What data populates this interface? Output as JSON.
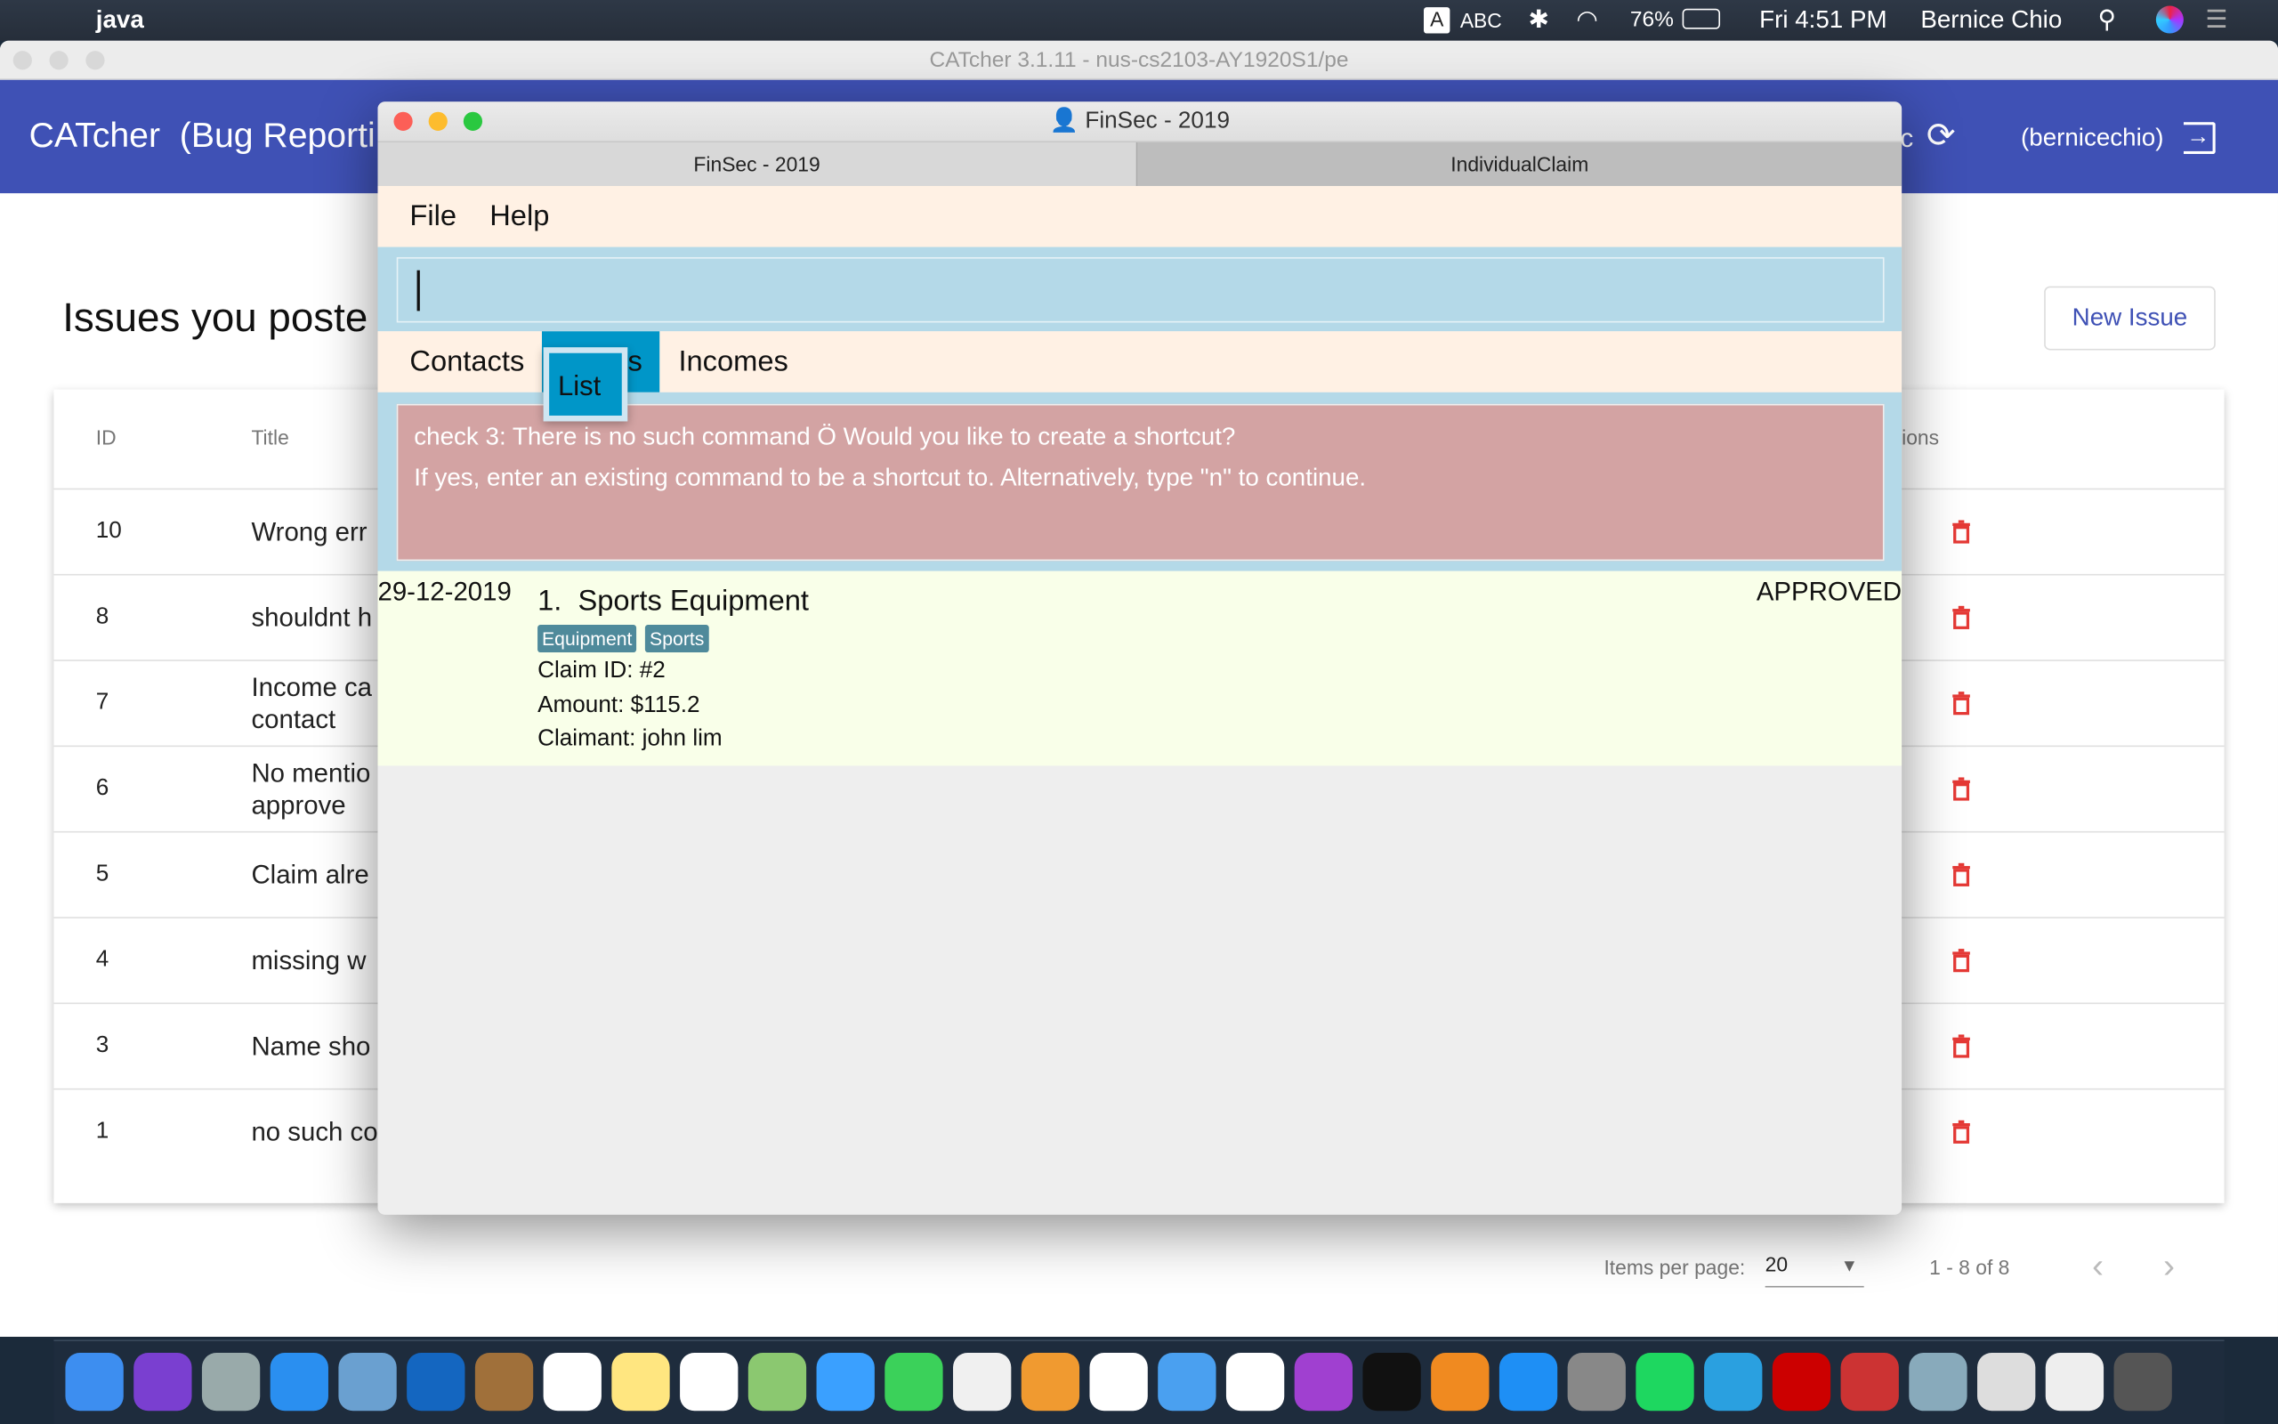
{
  "menubar": {
    "app": "java",
    "input": "ABC",
    "battery": "76%",
    "clock": "Fri 4:51 PM",
    "user": "Bernice Chio"
  },
  "catcher": {
    "window_title": "CATcher 3.1.11 - nus-cs2103-AY1920S1/pe",
    "header_title": "CATcher  (Bug Reporti",
    "header_partial": "c",
    "username": "(bernicechio)",
    "page_title": "Issues you poste",
    "new_issue": "New Issue",
    "columns": {
      "id": "ID",
      "title": "Title",
      "actions": "ions"
    },
    "rows": [
      {
        "id": "10",
        "title": "Wrong err"
      },
      {
        "id": "8",
        "title": "shouldnt h"
      },
      {
        "id": "7",
        "title": "Income ca\ncontact"
      },
      {
        "id": "6",
        "title": "No mentio\napprove"
      },
      {
        "id": "5",
        "title": "Claim alre"
      },
      {
        "id": "4",
        "title": "missing w"
      },
      {
        "id": "3",
        "title": "Name sho"
      },
      {
        "id": "1",
        "title": "no such co"
      }
    ],
    "paginator": {
      "label": "Items per page:",
      "page_size": "20",
      "range": "1 - 8 of 8"
    },
    "delete_color": "#e53935",
    "accent": "#3f51b5"
  },
  "finsec": {
    "window_title": "FinSec - 2019",
    "tabs": [
      "FinSec - 2019",
      "IndividualClaim"
    ],
    "menu": [
      "File",
      "Help"
    ],
    "command_value": "",
    "nav_tabs": [
      "Contacts",
      "Claims",
      "Incomes"
    ],
    "selected_tab": "Claims",
    "popup_item": "List",
    "result_lines": [
      "check 3: There is no such command Ö Would you like to create a shortcut?",
      "If yes, enter an existing command to be a shortcut to. Alternatively, type \"n\" to continue."
    ],
    "claim": {
      "date": "29-12-2019",
      "title": "1.  Sports Equipment",
      "tags": [
        "Equipment",
        "Sports"
      ],
      "claim_id": "Claim ID: #2",
      "amount": "Amount: $115.2",
      "claimant": "Claimant: john lim",
      "status": "APPROVED"
    }
  }
}
